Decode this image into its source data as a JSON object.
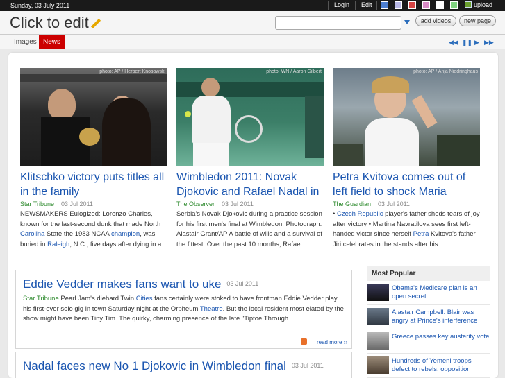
{
  "topbar": {
    "date": "Sunday, 03 July 2011",
    "login": "Login",
    "edit": "Edit",
    "upload": "upload",
    "swatches": [
      "#4d7fd1",
      "#b8b8e6",
      "#d64545",
      "#d98ac6",
      "#ffffff",
      "#7fd17f"
    ]
  },
  "header": {
    "title": "Click to edit",
    "search_value": "",
    "add_videos": "add videos",
    "new_page": "new page"
  },
  "tabs": [
    {
      "label": "Images"
    },
    {
      "label": "News"
    }
  ],
  "controls": {
    "prev": "◀◀",
    "pause": "❚❚",
    "next": "▶",
    "last": "▶▶"
  },
  "featured": [
    {
      "credit": "photo: AP / Herbert Knosowski",
      "title": "Klitschko victory puts titles all in the family",
      "source": "Star Tribune",
      "date": "03 Jul 2011",
      "blurb_1": "NEWSMAKERS Eulogized: Lorenzo Charles, known for the last-second dunk that made North ",
      "blurb_link1": "Carolina",
      "blurb_2": " State the 1983 NCAA ",
      "blurb_link2": "champion",
      "blurb_3": ", was buried in ",
      "blurb_link3": "Raleigh",
      "blurb_4": ", N.C., five days after dying in a bus wreck...."
    },
    {
      "credit": "photo: WN / Aaron Gilbert",
      "title": "Wimbledon 2011: Novak Djokovic and Rafael Nadal in",
      "source": "The Observer",
      "date": "03 Jul 2011",
      "blurb": "Serbia's Novak Djokovic during a practice session for his first men's final at Wimbledon. Photograph: Alastair Grant/AP A battle of wills and a survival of the fittest. Over the past 10 months, Rafael..."
    },
    {
      "credit": "photo: AP / Anja Niedringhaus",
      "title": "Petra Kvitova comes out of left field to shock Maria",
      "source": "The Guardian",
      "date": "03 Jul 2011",
      "blurb_1": "• ",
      "blurb_link1": "Czech Republic",
      "blurb_2": " player's father sheds tears of joy after victory • Martina Navratilova sees first left-handed victor since herself ",
      "blurb_link2": "Petra",
      "blurb_3": " Kvitova's father Jiri celebrates in the stands after his..."
    }
  ],
  "articles": [
    {
      "title": "Eddie Vedder makes fans want to uke",
      "date": "03 Jul 2011",
      "source": "Star Tribune",
      "body_1": "   Pearl Jam's diehard Twin ",
      "body_link1": "Cities",
      "body_2": " fans certainly were stoked to have frontman Eddie Vedder play his first-ever solo gig in town Saturday night at the Orpheum ",
      "body_link2": "Theatre",
      "body_3": ". But the local resident most elated by the show might have been Tiny Tim. The quirky, charming presence of the late \"Tiptoe Through...",
      "read_more": "read more"
    },
    {
      "title": "Nadal faces new No 1 Djokovic in Wimbledon final",
      "date": "03 Jul 2011"
    }
  ],
  "popular": {
    "heading": "Most Popular",
    "items": [
      {
        "text": "Obama's Medicare plan is an open secret"
      },
      {
        "text": "Alastair Campbell: Blair was angry at Prince's interference"
      },
      {
        "text": "Greece passes key austerity vote"
      },
      {
        "text": "Hundreds of Yemeni troops defect to rebels: opposition"
      }
    ]
  }
}
